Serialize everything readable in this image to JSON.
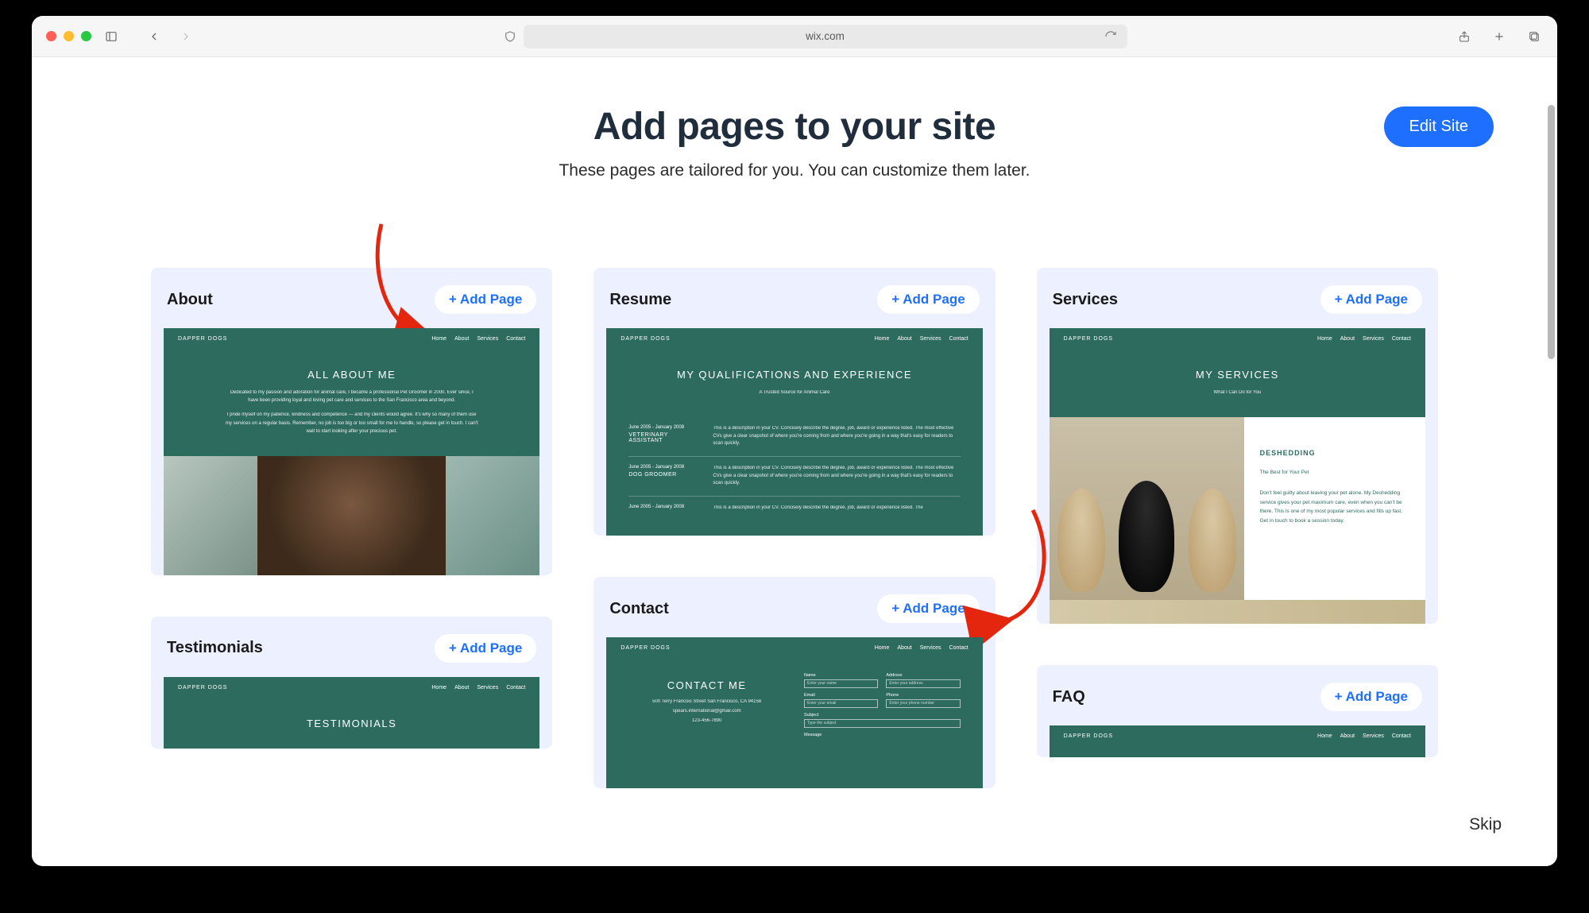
{
  "browser": {
    "url": "wix.com"
  },
  "header": {
    "title": "Add pages to your site",
    "subtitle": "These pages are tailored for you. You can customize them later.",
    "edit_button": "Edit Site"
  },
  "skip_label": "Skip",
  "add_page_label": "+ Add Page",
  "brand": "DAPPER DOGS",
  "nav_links": [
    "Home",
    "About",
    "Services",
    "Contact"
  ],
  "cards": {
    "about": {
      "title": "About",
      "hero": "ALL ABOUT ME",
      "p1": "Dedicated to my passion and adoration for animal care, I became a professional Pet Groomer in 2000. Ever since, I have been providing loyal and loving pet care and services to the San Francisco area and beyond.",
      "p2": "I pride myself on my patience, kindness and competence — and my clients would agree. It's why so many of them use my services on a regular basis. Remember, no job is too big or too small for me to handle, so please get in touch. I can't wait to start looking after your precious pet."
    },
    "resume": {
      "title": "Resume",
      "hero": "MY QUALIFICATIONS AND EXPERIENCE",
      "sub": "A Trusted Source for Animal Care",
      "rows": [
        {
          "dates": "June 2005 - January 2008",
          "role": "VETERINARY ASSISTANT",
          "desc": "This is a description in your CV. Concisely describe the degree, job, award or experience listed. The most effective CVs give a clear snapshot of where you're coming from and where you're going in a way that's easy for readers to scan quickly."
        },
        {
          "dates": "June 2005 - January 2008",
          "role": "DOG GROOMER",
          "desc": "This is a description in your CV. Concisely describe the degree, job, award or experience listed. The most effective CVs give a clear snapshot of where you're coming from and where you're going in a way that's easy for readers to scan quickly."
        },
        {
          "dates": "June 2005 - January 2008",
          "role": "",
          "desc": "This is a description in your CV. Concisely describe the degree, job, award or experience listed. The"
        }
      ]
    },
    "services": {
      "title": "Services",
      "hero": "MY SERVICES",
      "sub": "What I Can Do for You",
      "item_title": "DESHEDDING",
      "item_sub": "The Best for Your Pet",
      "item_desc": "Don't feel guilty about leaving your pet alone. My Deshedding service gives your pet maximum care, even when you can't be there. This is one of my most popular services and fills up fast. Get in touch to book a session today."
    },
    "contact": {
      "title": "Contact",
      "hero": "CONTACT ME",
      "addr": "500 Terry Francois Street San Francisco, CA 94158",
      "email": "spears.international@gmail.com",
      "phone": "123-456-7890",
      "fields": {
        "name": "Name",
        "name_ph": "Enter your name",
        "address": "Address",
        "address_ph": "Enter your address",
        "email_l": "Email",
        "email_ph": "Enter your email",
        "phone_l": "Phone",
        "phone_ph": "Enter your phone number",
        "subject": "Subject",
        "subject_ph": "Type the subject",
        "message": "Message"
      }
    },
    "testimonials": {
      "title": "Testimonials",
      "hero": "TESTIMONIALS"
    },
    "faq": {
      "title": "FAQ"
    }
  }
}
